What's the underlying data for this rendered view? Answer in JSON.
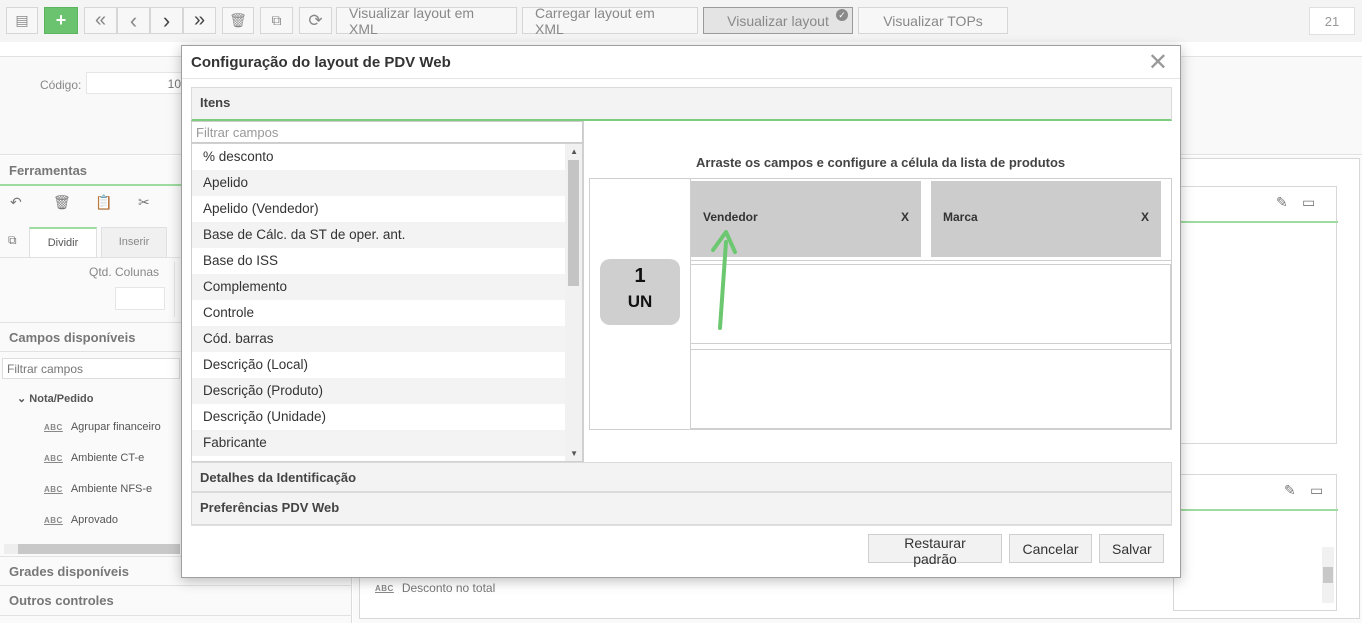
{
  "toolbar": {
    "counter": "21",
    "buttons": [
      {
        "name": "grid-view-button",
        "glyph": "▤"
      },
      {
        "name": "add-button",
        "glyph": "+"
      },
      {
        "name": "first-page-button",
        "glyph": "«"
      },
      {
        "name": "previous-button",
        "glyph": "‹"
      },
      {
        "name": "next-button",
        "glyph": "›"
      },
      {
        "name": "last-page-button",
        "glyph": "»"
      },
      {
        "name": "delete-button",
        "glyph": "🗑"
      },
      {
        "name": "copy-button",
        "glyph": "⧉"
      },
      {
        "name": "refresh-button",
        "glyph": "⟳"
      }
    ],
    "text_buttons": {
      "view_xml": "Visualizar layout em XML",
      "load_xml": "Carregar layout em XML",
      "view_layout": "Visualizar layout",
      "view_tops": "Visualizar TOPs"
    }
  },
  "background": {
    "codigo_label": "Código:",
    "codigo_value": "10",
    "ferramentas": "Ferramentas",
    "tabs": {
      "dividir": "Dividir",
      "inserir": "Inserir"
    },
    "qtd_colunas_label": "Qtd. Colunas",
    "campos_disponiveis": "Campos disponíveis",
    "filtrar_placeholder": "Filtrar campos",
    "tree_root": "Nota/Pedido",
    "tree_items": [
      "Agrupar financeiro",
      "Ambiente CT-e",
      "Ambiente NFS-e",
      "Aprovado"
    ],
    "grades_disponiveis": "Grades disponíveis",
    "outros_controles": "Outros controles",
    "desconto_item": "Desconto no total",
    "abc": "ABC"
  },
  "modal": {
    "title": "Configuração do layout de PDV Web",
    "close_glyph": "✕",
    "sections": {
      "itens": "Itens",
      "detalhes": "Detalhes da Identificação",
      "preferencias": "Preferências PDV Web"
    },
    "filter_placeholder": "Filtrar campos",
    "fields": [
      "% desconto",
      "Apelido",
      "Apelido (Vendedor)",
      "Base de Cálc. da ST de oper. ant.",
      "Base do ISS",
      "Complemento",
      "Controle",
      "Cód. barras",
      "Descrição (Local)",
      "Descrição (Produto)",
      "Descrição (Unidade)",
      "Fabricante"
    ],
    "layout_instruction": "Arraste os campos e configure a célula da lista de produtos",
    "preview": {
      "quantity": "1",
      "unit": "UN"
    },
    "placed_fields": [
      {
        "label": "Vendedor",
        "remove": "X"
      },
      {
        "label": "Marca",
        "remove": "X"
      }
    ],
    "buttons": {
      "restore": "Restaurar padrão",
      "cancel": "Cancelar",
      "save": "Salvar"
    }
  },
  "colors": {
    "accent_green": "#6cc36f",
    "annotation_arrow": "#6cc870",
    "chip_gray": "#cccccc"
  }
}
